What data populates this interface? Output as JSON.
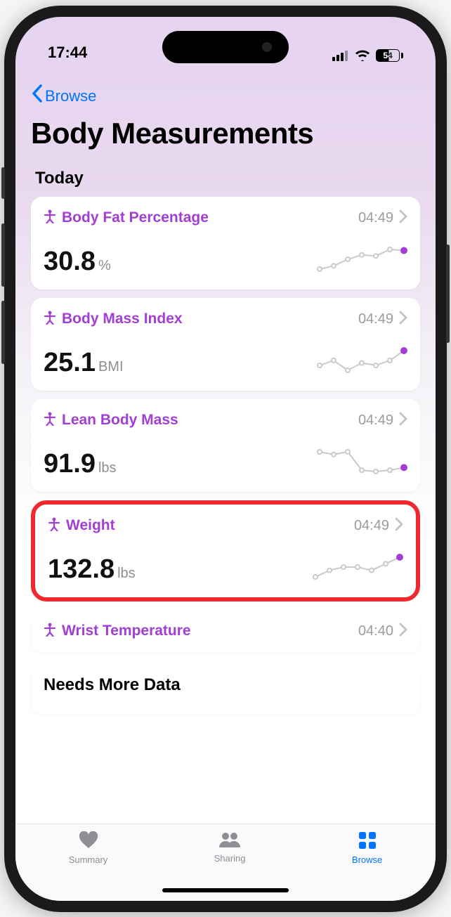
{
  "status": {
    "time": "17:44",
    "battery": "54"
  },
  "nav": {
    "back_label": "Browse"
  },
  "title": "Body Measurements",
  "section_today": "Today",
  "cards": [
    {
      "title": "Body Fat Percentage",
      "time": "04:49",
      "value": "30.8",
      "unit": "%",
      "spark": [
        5,
        8,
        14,
        18,
        17,
        23,
        22
      ]
    },
    {
      "title": "Body Mass Index",
      "time": "04:49",
      "value": "25.1",
      "unit": "BMI",
      "spark": [
        12,
        14,
        10,
        13,
        12,
        14,
        18
      ]
    },
    {
      "title": "Lean Body Mass",
      "time": "04:49",
      "value": "91.9",
      "unit": "lbs",
      "spark": [
        22,
        20,
        22,
        8,
        7,
        8,
        10
      ]
    },
    {
      "title": "Weight",
      "time": "04:49",
      "value": "132.8",
      "unit": "lbs",
      "spark": [
        12,
        14,
        15,
        15,
        14,
        16,
        18
      ],
      "highlight": true
    },
    {
      "title": "Wrist Temperature",
      "time": "04:40",
      "plain": true
    }
  ],
  "needs_more": "Needs More Data",
  "tabs": [
    {
      "label": "Summary",
      "icon": "heart",
      "active": false
    },
    {
      "label": "Sharing",
      "icon": "people",
      "active": false
    },
    {
      "label": "Browse",
      "icon": "grid",
      "active": true
    }
  ]
}
